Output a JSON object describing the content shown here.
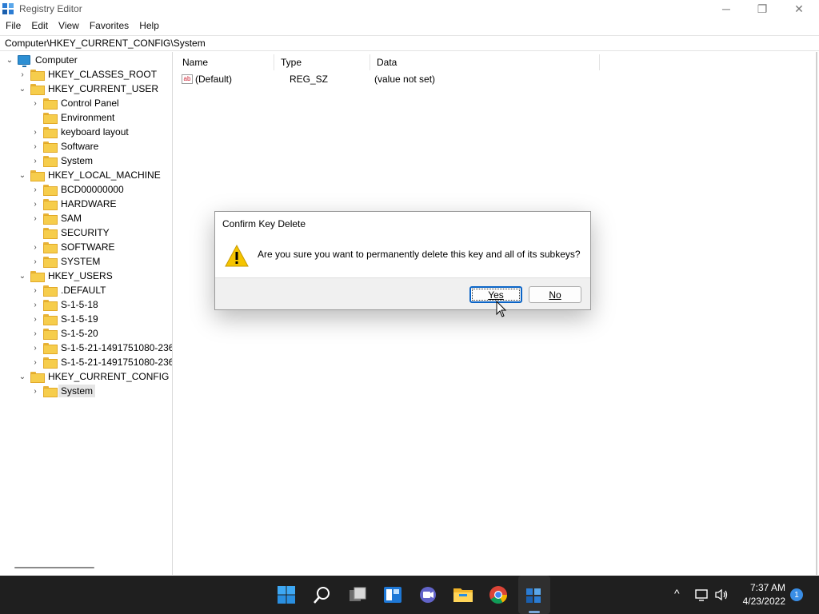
{
  "window": {
    "title": "Registry Editor",
    "controls": {
      "minimize": "─",
      "maximize": "❐",
      "close": "✕"
    }
  },
  "menu": [
    "File",
    "Edit",
    "View",
    "Favorites",
    "Help"
  ],
  "address": "Computer\\HKEY_CURRENT_CONFIG\\System",
  "tree": [
    {
      "label": "Computer",
      "level": 0,
      "expander": "expanded",
      "icon": "computer-icon"
    },
    {
      "label": "HKEY_CLASSES_ROOT",
      "level": 1,
      "expander": "collapsed",
      "icon": "folder-icon"
    },
    {
      "label": "HKEY_CURRENT_USER",
      "level": 1,
      "expander": "expanded",
      "icon": "folder-icon"
    },
    {
      "label": "Control Panel",
      "level": 2,
      "expander": "collapsed",
      "icon": "folder-icon"
    },
    {
      "label": "Environment",
      "level": 2,
      "expander": "none",
      "icon": "folder-icon"
    },
    {
      "label": "keyboard layout",
      "level": 2,
      "expander": "collapsed",
      "icon": "folder-icon"
    },
    {
      "label": "Software",
      "level": 2,
      "expander": "collapsed",
      "icon": "folder-icon"
    },
    {
      "label": "System",
      "level": 2,
      "expander": "collapsed",
      "icon": "folder-icon"
    },
    {
      "label": "HKEY_LOCAL_MACHINE",
      "level": 1,
      "expander": "expanded",
      "icon": "folder-icon"
    },
    {
      "label": "BCD00000000",
      "level": 2,
      "expander": "collapsed",
      "icon": "folder-icon"
    },
    {
      "label": "HARDWARE",
      "level": 2,
      "expander": "collapsed",
      "icon": "folder-icon"
    },
    {
      "label": "SAM",
      "level": 2,
      "expander": "collapsed",
      "icon": "folder-icon"
    },
    {
      "label": "SECURITY",
      "level": 2,
      "expander": "none",
      "icon": "folder-icon"
    },
    {
      "label": "SOFTWARE",
      "level": 2,
      "expander": "collapsed",
      "icon": "folder-icon"
    },
    {
      "label": "SYSTEM",
      "level": 2,
      "expander": "collapsed",
      "icon": "folder-icon"
    },
    {
      "label": "HKEY_USERS",
      "level": 1,
      "expander": "expanded",
      "icon": "folder-icon"
    },
    {
      "label": ".DEFAULT",
      "level": 2,
      "expander": "collapsed",
      "icon": "folder-icon"
    },
    {
      "label": "S-1-5-18",
      "level": 2,
      "expander": "collapsed",
      "icon": "folder-icon"
    },
    {
      "label": "S-1-5-19",
      "level": 2,
      "expander": "collapsed",
      "icon": "folder-icon"
    },
    {
      "label": "S-1-5-20",
      "level": 2,
      "expander": "collapsed",
      "icon": "folder-icon"
    },
    {
      "label": "S-1-5-21-1491751080-2360",
      "level": 2,
      "expander": "collapsed",
      "icon": "folder-icon"
    },
    {
      "label": "S-1-5-21-1491751080-2360",
      "level": 2,
      "expander": "collapsed",
      "icon": "folder-icon"
    },
    {
      "label": "HKEY_CURRENT_CONFIG",
      "level": 1,
      "expander": "expanded",
      "icon": "folder-icon"
    },
    {
      "label": "System",
      "level": 2,
      "expander": "collapsed",
      "icon": "folder-icon",
      "selected": true
    }
  ],
  "list": {
    "headers": {
      "name": "Name",
      "type": "Type",
      "data": "Data"
    },
    "rows": [
      {
        "icon": "ab",
        "name": "(Default)",
        "type": "REG_SZ",
        "data": "(value not set)"
      }
    ]
  },
  "dialog": {
    "title": "Confirm Key Delete",
    "message": "Are you sure you want to permanently delete this key and all of its subkeys?",
    "yes_label": "Yes",
    "no_label": "No"
  },
  "taskbar": {
    "apps": [
      "start-icon",
      "search-icon",
      "task-view-icon",
      "widgets-icon",
      "chat-icon",
      "file-explorer-icon",
      "chrome-icon",
      "registry-editor-icon"
    ],
    "tray_chevron": "^",
    "time": "7:37 AM",
    "date": "4/23/2022",
    "notification_count": "1"
  },
  "colors": {
    "accent": "#0b64c6",
    "folder": "#f6cd4c",
    "taskbar": "#1f1f1f",
    "warning": "#f5c400"
  }
}
